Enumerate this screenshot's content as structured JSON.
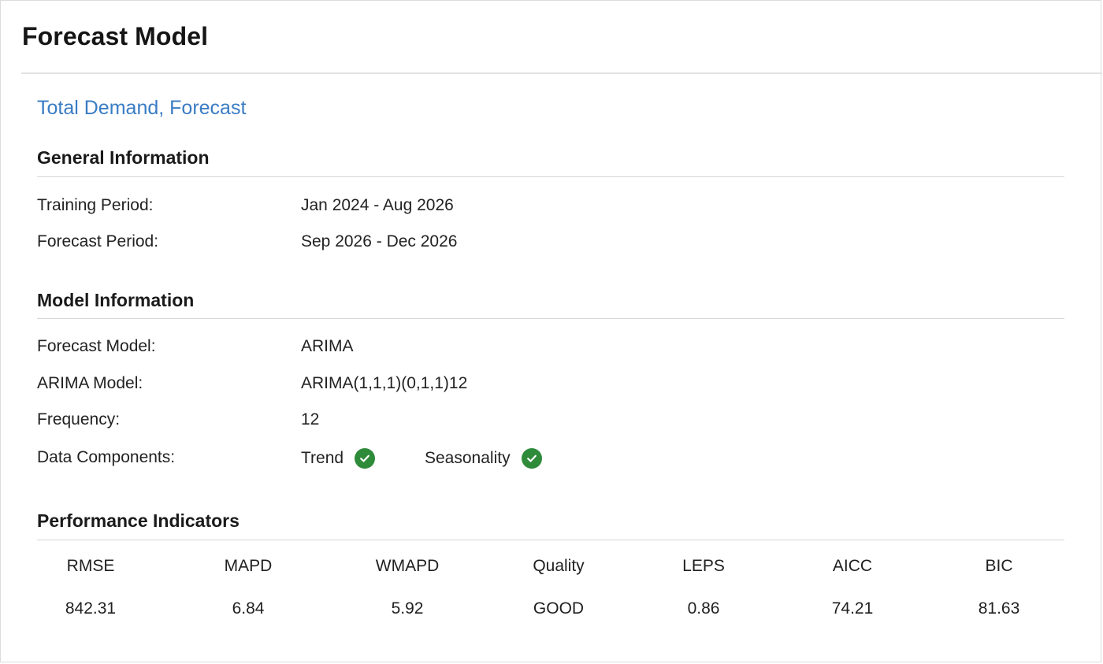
{
  "page": {
    "title": "Forecast Model",
    "subtitle": "Total Demand, Forecast"
  },
  "general": {
    "heading": "General Information",
    "training_label": "Training Period:",
    "training_value": "Jan 2024 - Aug 2026",
    "forecast_label": "Forecast Period:",
    "forecast_value": "Sep 2026 - Dec 2026"
  },
  "model": {
    "heading": "Model Information",
    "forecast_model_label": "Forecast Model:",
    "forecast_model_value": "ARIMA",
    "arima_label": "ARIMA Model:",
    "arima_value": "ARIMA(1,1,1)(0,1,1)12",
    "frequency_label": "Frequency:",
    "frequency_value": "12",
    "components_label": "Data Components:",
    "components": [
      {
        "label": "Trend",
        "icon": "check-circle-icon"
      },
      {
        "label": "Seasonality",
        "icon": "check-circle-icon"
      }
    ]
  },
  "performance": {
    "heading": "Performance Indicators",
    "metrics": [
      {
        "name": "RMSE",
        "value": "842.31"
      },
      {
        "name": "MAPD",
        "value": "6.84"
      },
      {
        "name": "WMAPD",
        "value": "5.92"
      },
      {
        "name": "Quality",
        "value": "GOOD"
      },
      {
        "name": "LEPS",
        "value": "0.86"
      },
      {
        "name": "AICC",
        "value": "74.21"
      },
      {
        "name": "BIC",
        "value": "81.63"
      }
    ]
  },
  "colors": {
    "accent": "#3a7cc4",
    "success": "#2e8b3a"
  }
}
